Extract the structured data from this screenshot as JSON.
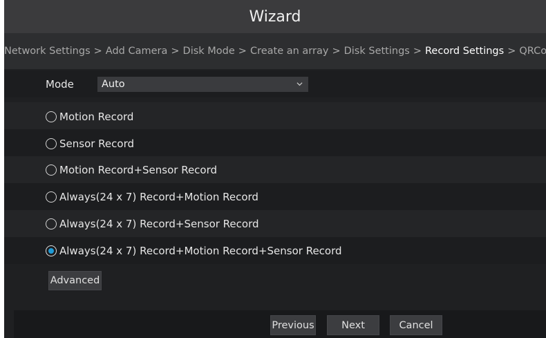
{
  "window": {
    "title": "Wizard"
  },
  "breadcrumb": {
    "items": [
      {
        "label": "Network Settings",
        "active": false
      },
      {
        "label": "Add Camera",
        "active": false
      },
      {
        "label": "Disk Mode",
        "active": false
      },
      {
        "label": "Create an array",
        "active": false
      },
      {
        "label": "Disk Settings",
        "active": false
      },
      {
        "label": "Record Settings",
        "active": true
      },
      {
        "label": "QRCode",
        "active": false
      }
    ],
    "separator": ">"
  },
  "mode": {
    "label": "Mode",
    "value": "Auto"
  },
  "options": [
    {
      "label": "Motion Record",
      "checked": false
    },
    {
      "label": "Sensor Record",
      "checked": false
    },
    {
      "label": "Motion Record+Sensor Record",
      "checked": false
    },
    {
      "label": "Always(24 x 7) Record+Motion Record",
      "checked": false
    },
    {
      "label": "Always(24 x 7) Record+Sensor Record",
      "checked": false
    },
    {
      "label": "Always(24 x 7) Record+Motion Record+Sensor Record",
      "checked": true
    }
  ],
  "buttons": {
    "advanced": "Advanced",
    "previous": "Previous",
    "next": "Next",
    "cancel": "Cancel"
  },
  "colors": {
    "accent": "#1e9bd7"
  }
}
